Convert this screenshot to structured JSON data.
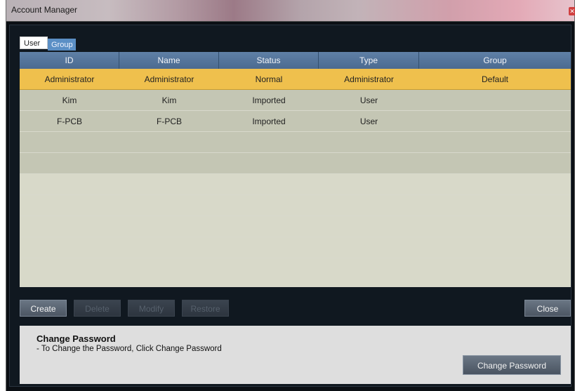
{
  "window": {
    "title": "Account Manager"
  },
  "tabs": [
    {
      "label": "User",
      "active": true
    },
    {
      "label": "Group",
      "active": false
    }
  ],
  "table": {
    "columns": [
      "ID",
      "Name",
      "Status",
      "Type",
      "Group"
    ],
    "rows": [
      [
        "Administrator",
        "Administrator",
        "Normal",
        "Administrator",
        "Default"
      ],
      [
        "Kim",
        "Kim",
        "Imported",
        "User",
        ""
      ],
      [
        "F-PCB",
        "F-PCB",
        "Imported",
        "User",
        ""
      ]
    ],
    "selected_row": 0
  },
  "actions": {
    "create": "Create",
    "delete": "Delete",
    "modify": "Modify",
    "restore": "Restore",
    "close": "Close"
  },
  "password_panel": {
    "title": "Change Password",
    "description": "- To Change the Password, Click Change Password",
    "button": "Change Password"
  },
  "colors": {
    "selected_row": "#efc04d",
    "header": "#4b6a90",
    "tab_inactive": "#5b8fc5"
  }
}
